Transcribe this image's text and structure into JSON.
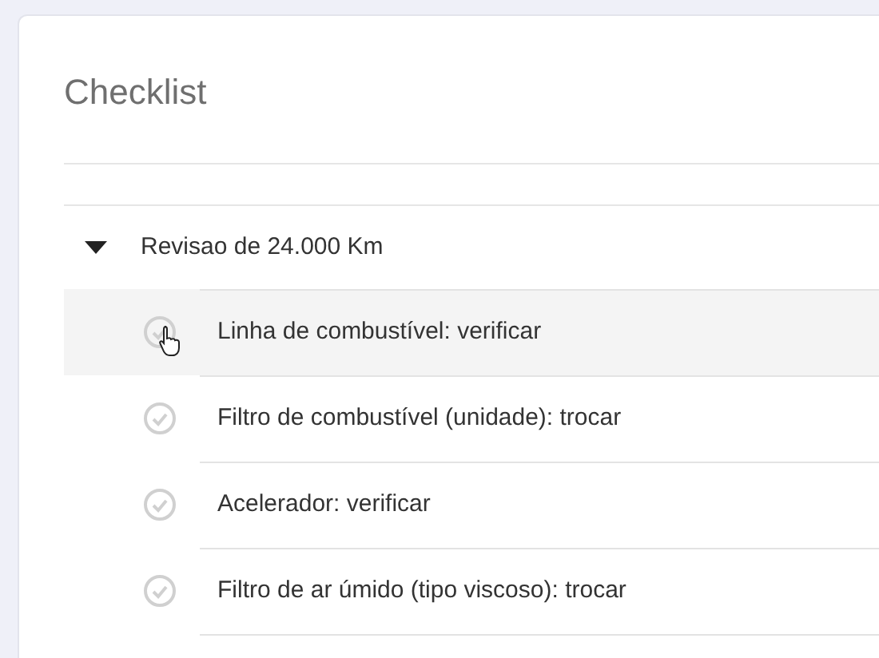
{
  "card": {
    "title": "Checklist"
  },
  "group": {
    "label": "Revisao de 24.000 Km",
    "expanded": true,
    "items": [
      {
        "label": "Linha de combustível: verificar",
        "checked": false,
        "hovered": true
      },
      {
        "label": "Filtro de combustível (unidade): trocar",
        "checked": false,
        "hovered": false
      },
      {
        "label": "Acelerador: verificar",
        "checked": false,
        "hovered": false
      },
      {
        "label": "Filtro de ar úmido (tipo viscoso): trocar",
        "checked": false,
        "hovered": false
      }
    ]
  }
}
